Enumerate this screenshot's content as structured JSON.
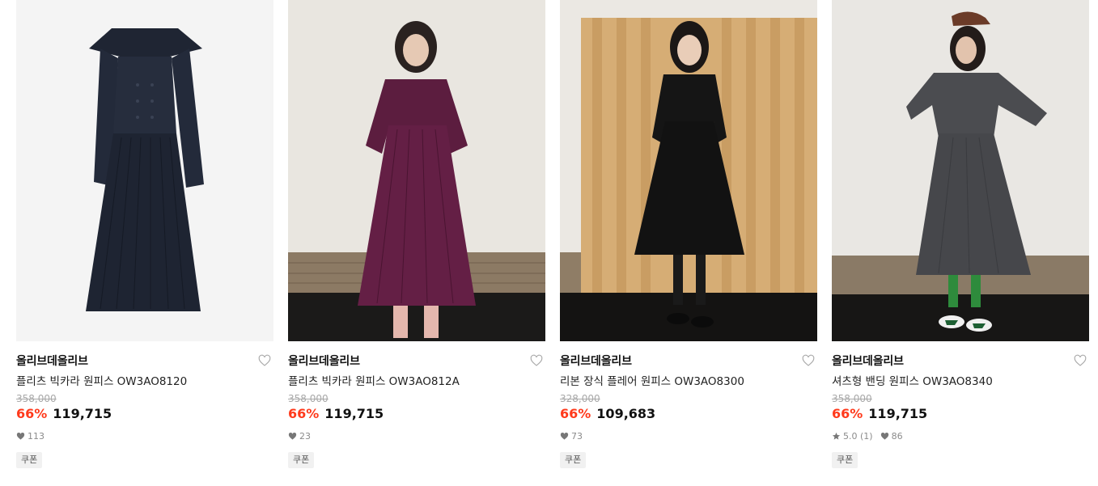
{
  "products": [
    {
      "brand": "올리브데올리브",
      "name": "플리츠 빅카라 원피스 OW3AO8120",
      "original_price": "358,000",
      "discount": "66%",
      "price": "119,715",
      "likes": "113",
      "rating": null,
      "coupon": "쿠폰",
      "image": "navy pleated big-collar dress on white background"
    },
    {
      "brand": "올리브데올리브",
      "name": "플리츠 빅카라 원피스 OW3AO812A",
      "original_price": "358,000",
      "discount": "66%",
      "price": "119,715",
      "likes": "23",
      "rating": null,
      "coupon": "쿠폰",
      "image": "model in burgundy pleated dress"
    },
    {
      "brand": "올리브데올리브",
      "name": "리본 장식 플레어 원피스 OW3AO8300",
      "original_price": "328,000",
      "discount": "66%",
      "price": "109,683",
      "likes": "73",
      "rating": null,
      "coupon": "쿠폰",
      "image": "model in black flare dress in front of wooden screen"
    },
    {
      "brand": "올리브데올리브",
      "name": "셔츠형 밴딩 원피스 OW3AO8340",
      "original_price": "358,000",
      "discount": "66%",
      "price": "119,715",
      "likes": "86",
      "rating": "5.0 (1)",
      "coupon": "쿠폰",
      "image": "model in charcoal shirt dress with cap"
    }
  ],
  "colors": {
    "discount": "#ff3a1c",
    "muted": "#8b8b8b",
    "strike": "#a8a8a8"
  }
}
